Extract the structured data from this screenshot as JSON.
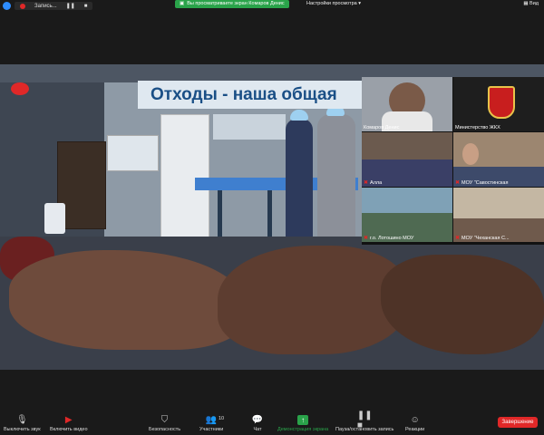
{
  "topbar": {
    "record_label": "Запись...",
    "share_notice": "Вы просматриваете экран Комаров Денис",
    "view_options": "Настройки просмотра",
    "view_label": "Вид"
  },
  "slide": {
    "banner": "Отходы - наша общая"
  },
  "gallery": {
    "tiles": [
      {
        "name": "Комаров Денис",
        "muted": false
      },
      {
        "name": "Министерство ЖКХ",
        "muted": false
      },
      {
        "name": "Алла",
        "muted": true
      },
      {
        "name": "МОУ \"Савостинская",
        "muted": true
      },
      {
        "name": "г.о. Лотошино МОУ",
        "muted": true
      },
      {
        "name": "МОУ \"Чеханская С...",
        "muted": true
      }
    ]
  },
  "toolbar": {
    "mute_label": "Выключить звук",
    "video_label": "Включить видео",
    "security_label": "Безопасность",
    "participants_label": "Участники",
    "participants_count": "10",
    "chat_label": "Чат",
    "share_label": "Демонстрация экрана",
    "pause_record_label": "Пауза/остановить запись",
    "reactions_label": "Реакции",
    "end_label": "Завершение"
  },
  "colors": {
    "accent": "#2d8cff",
    "share_green": "#2aa34a",
    "end_red": "#e02828"
  }
}
